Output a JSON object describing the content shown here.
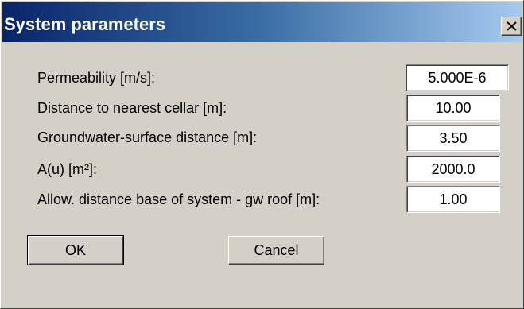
{
  "dialog": {
    "title": "System parameters",
    "close_glyph": "×"
  },
  "params": [
    {
      "label": "Permeability [m/s]:",
      "value": "5.000E-6"
    },
    {
      "label": "Distance to nearest cellar [m]:",
      "value": "10.00"
    },
    {
      "label": "Groundwater-surface distance [m]:",
      "value": "3.50"
    },
    {
      "label": "A(u) [m²]:",
      "value": "2000.0"
    },
    {
      "label": "Allow. distance base of system - gw roof [m]:",
      "value": "1.00"
    }
  ],
  "buttons": {
    "ok_label": "OK",
    "cancel_label": "Cancel"
  },
  "icons": {
    "close": "close-icon"
  }
}
